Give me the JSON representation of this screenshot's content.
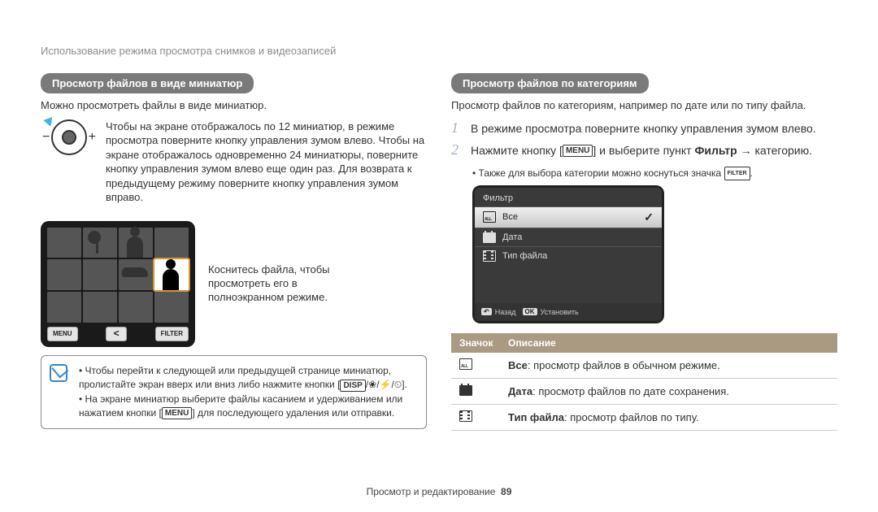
{
  "header_title": "Использование режима просмотра снимков и видеозаписей",
  "left": {
    "pill": "Просмотр файлов в виде миниатюр",
    "intro": "Можно просмотреть файлы в виде миниатюр.",
    "dial_text": "Чтобы на экране отображалось по 12 миниатюр, в режиме просмотра поверните кнопку управления зумом влево. Чтобы на экране отображалось одновременно 24 миниатюры, поверните кнопку управления зумом влево еще один раз. Для возврата к предыдущему режиму поверните кнопку управления зумом вправо.",
    "thumb_btn_menu": "MENU",
    "thumb_btn_filter": "FILTER",
    "callout": "Коснитесь файла, чтобы просмотреть его в полноэкранном режиме.",
    "note_line1_pre": "Чтобы перейти к следующей или предыдущей странице миниатюр, пролистайте экран вверх или вниз либо нажмите кнопки [",
    "note_line1_disp": "DISP",
    "note_line1_post": "].",
    "note_flower": "/",
    "note_bolt": "/",
    "note_timer": "/",
    "note_line2_pre": "На экране миниатюр выберите файлы касанием и удерживанием или нажатием кнопки [",
    "note_line2_menu": "MENU",
    "note_line2_post": "] для последующего удаления или отправки."
  },
  "right": {
    "pill": "Просмотр файлов по категориям",
    "intro": "Просмотр файлов по категориям, например по дате или по типу файла.",
    "step1": "В режиме просмотра поверните кнопку управления зумом влево.",
    "step2_pre": "Нажмите кнопку [",
    "step2_menu": "MENU",
    "step2_mid": "] и выберите пункт ",
    "step2_filter": "Фильтр",
    "step2_arrow": " → ",
    "step2_post": "категорию.",
    "sub_bullet_pre": "Также для выбора категории можно коснуться значка ",
    "sub_bullet_key": "FILTER",
    "sub_bullet_post": ".",
    "filter_title": "Фильтр",
    "filter_all": "Все",
    "filter_date": "Дата",
    "filter_type": "Тип файла",
    "footer_back": "Назад",
    "footer_ok": "OK",
    "footer_set": "Установить",
    "table_h1": "Значок",
    "table_h2": "Описание",
    "row_all_bold": "Все",
    "row_all_rest": ": просмотр файлов в обычном режиме.",
    "row_date_bold": "Дата",
    "row_date_rest": ": просмотр файлов по дате сохранения.",
    "row_type_bold": "Тип файла",
    "row_type_rest": ": просмотр файлов по типу."
  },
  "footer": {
    "section": "Просмотр и редактирование",
    "page": "89"
  }
}
